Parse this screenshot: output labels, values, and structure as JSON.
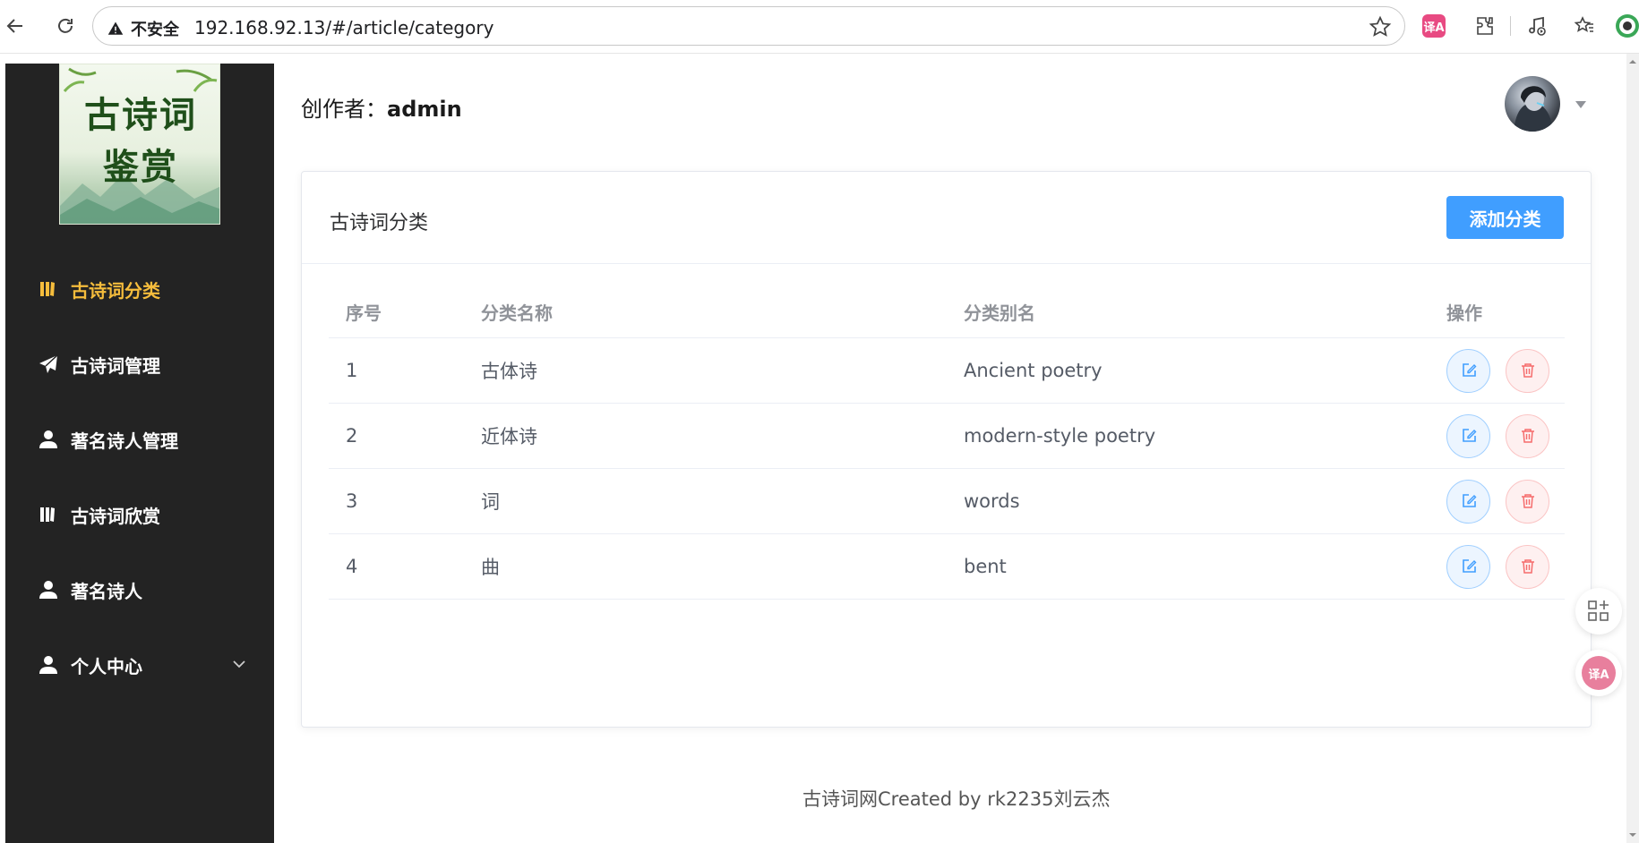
{
  "browser": {
    "insecure_label": "不安全",
    "url": "192.168.92.13/#/article/category",
    "translate_ext": "译A"
  },
  "sidebar": {
    "logo_text_line1": "古诗词",
    "logo_text_line2": "鉴赏",
    "items": [
      {
        "label": "古诗词分类",
        "icon": "book-icon",
        "active": true
      },
      {
        "label": "古诗词管理",
        "icon": "send-icon",
        "active": false
      },
      {
        "label": "著名诗人管理",
        "icon": "user-icon",
        "active": false
      },
      {
        "label": "古诗词欣赏",
        "icon": "book-icon",
        "active": false
      },
      {
        "label": "著名诗人",
        "icon": "user-icon",
        "active": false
      },
      {
        "label": "个人中心",
        "icon": "user-icon",
        "active": false,
        "has_submenu": true
      }
    ]
  },
  "header": {
    "creator_prefix": "创作者：",
    "creator_name": "admin"
  },
  "card": {
    "title": "古诗词分类",
    "add_button": "添加分类"
  },
  "table": {
    "headers": [
      "序号",
      "分类名称",
      "分类别名",
      "操作"
    ],
    "rows": [
      {
        "index": "1",
        "name": "古体诗",
        "alias": "Ancient poetry"
      },
      {
        "index": "2",
        "name": "近体诗",
        "alias": "modern-style poetry"
      },
      {
        "index": "3",
        "name": "词",
        "alias": "words"
      },
      {
        "index": "4",
        "name": "曲",
        "alias": "bent"
      }
    ]
  },
  "footer": {
    "text": "古诗词网Created by rk2235刘云杰"
  },
  "colors": {
    "sidebar_bg": "#232323",
    "active_menu": "#f6bd3c",
    "primary": "#409eff",
    "danger": "#f56c6c"
  }
}
